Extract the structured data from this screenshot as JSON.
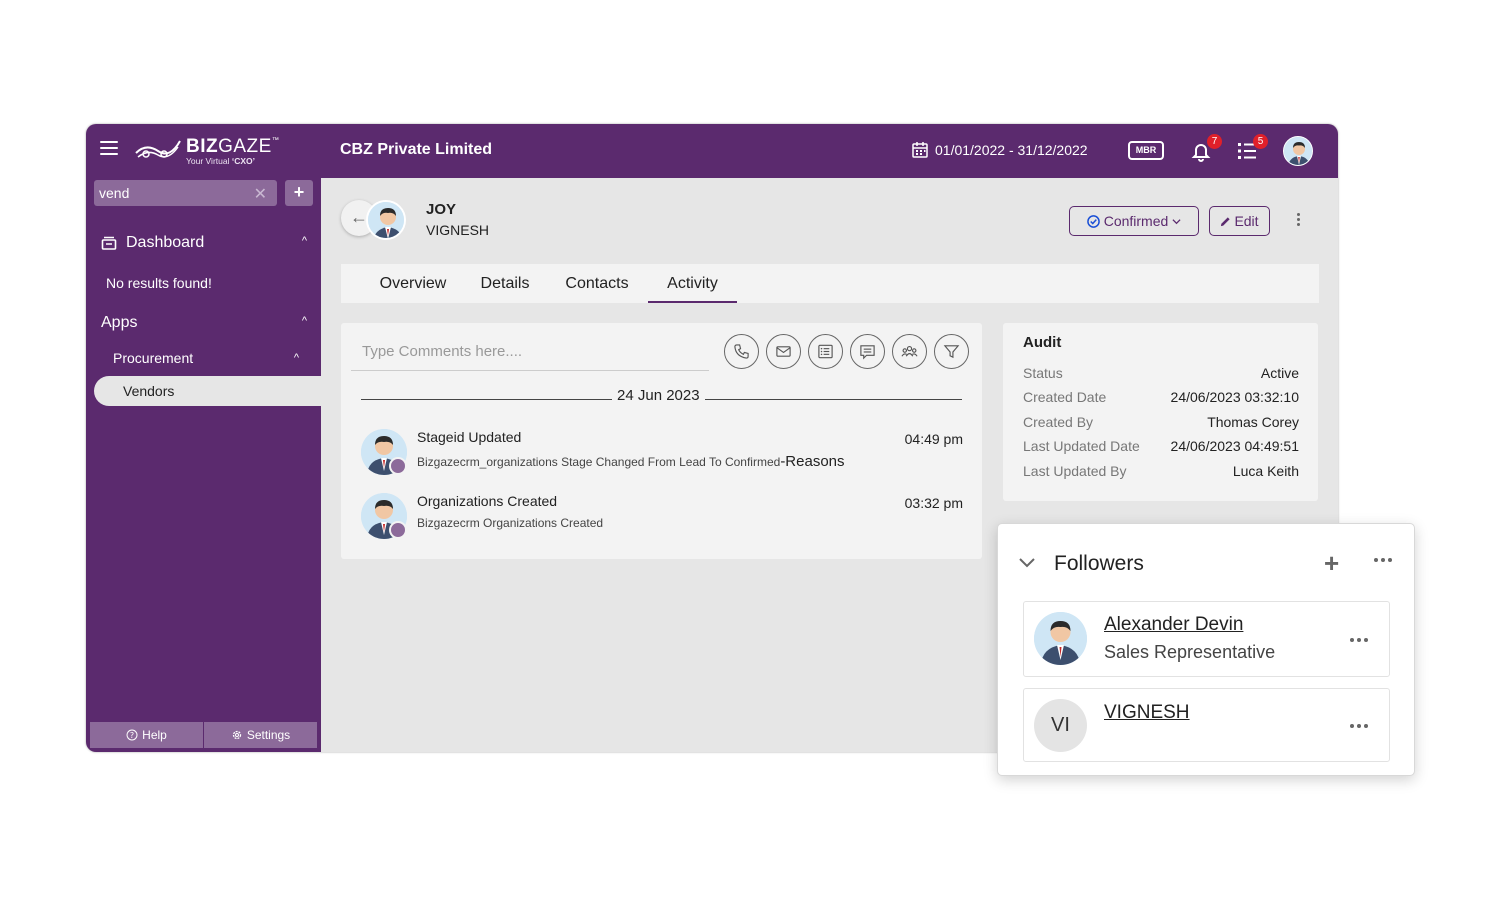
{
  "header": {
    "logo_brand": "BIZ",
    "logo_brand_2": "GAZE",
    "logo_tm": "™",
    "logo_tagline_prefix": "Your Virtual ",
    "logo_tagline_bold": "‘CXO’",
    "company": "CBZ Private Limited",
    "date_range": "01/01/2022 - 31/12/2022",
    "mbr_label": "MBR",
    "notification_count": "7",
    "task_count": "5",
    "brand_color": "#5b2a6e"
  },
  "sidebar": {
    "search_value": "vend",
    "clear_glyph": "✕",
    "add_glyph": "+",
    "dashboard_label": "Dashboard",
    "no_results": "No results found!",
    "apps_label": "Apps",
    "procurement_label": "Procurement",
    "vendors_label": "Vendors",
    "help_label": "Help",
    "settings_label": "Settings",
    "chevron_up": "^"
  },
  "record": {
    "name": "JOY",
    "subname": "VIGNESH",
    "status_label": "Confirmed",
    "edit_label": "Edit",
    "back_glyph": "←"
  },
  "tabs": [
    "Overview",
    "Details",
    "Contacts",
    "Activity"
  ],
  "activity": {
    "comment_placeholder": "Type Comments here....",
    "date_header": "24 Jun 2023",
    "entries": [
      {
        "title": "Stageid Updated",
        "description": "Bizgazecrm_organizations Stage Changed From Lead To Confirmed",
        "description_suffix": "-Reasons",
        "time": "04:49 pm"
      },
      {
        "title": "Organizations Created",
        "description": "Bizgazecrm Organizations Created",
        "time": "03:32 pm"
      }
    ]
  },
  "audit": {
    "title": "Audit",
    "rows": [
      {
        "label": "Status",
        "value": "Active"
      },
      {
        "label": "Created Date",
        "value": "24/06/2023 03:32:10"
      },
      {
        "label": "Created By",
        "value": "Thomas Corey"
      },
      {
        "label": "Last Updated Date",
        "value": "24/06/2023 04:49:51"
      },
      {
        "label": "Last Updated By",
        "value": "Luca Keith"
      }
    ]
  },
  "followers": {
    "title": "Followers",
    "add_glyph": "+",
    "items": [
      {
        "name": "Alexander Devin",
        "role": "Sales Representative",
        "initials": ""
      },
      {
        "name": "VIGNESH",
        "role": "",
        "initials": "VI"
      }
    ]
  }
}
